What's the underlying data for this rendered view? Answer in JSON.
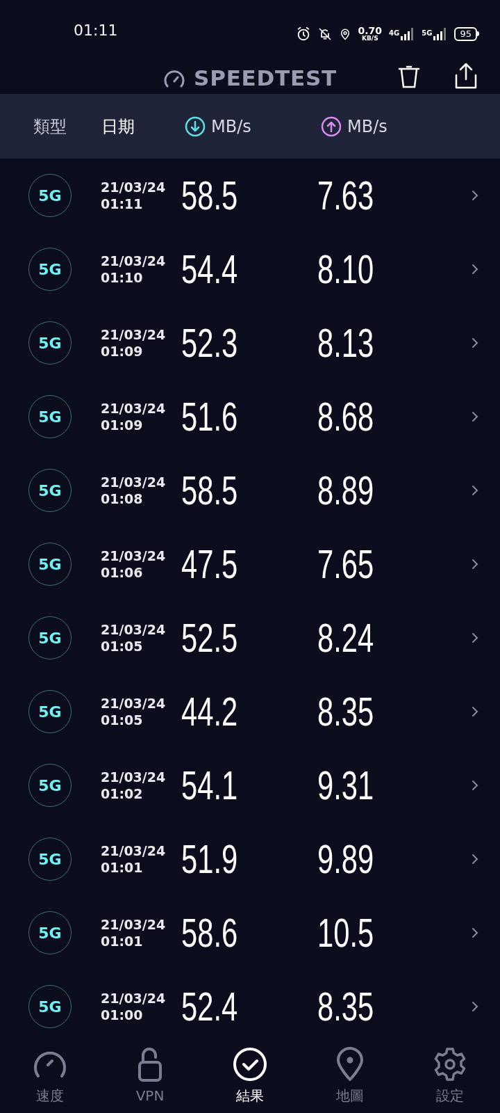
{
  "status_bar": {
    "time": "01:11",
    "net_speed": "0.70",
    "net_speed_unit": "KB/S",
    "network_1": "4G",
    "network_2": "5G",
    "battery": "95"
  },
  "header": {
    "title": "SPEEDTEST"
  },
  "columns": {
    "type": "類型",
    "date": "日期",
    "download": "MB/s",
    "upload": "MB/s"
  },
  "results": [
    {
      "type": "5G",
      "date": "21/03/24",
      "time": "01:11",
      "download": "58.5",
      "upload": "7.63"
    },
    {
      "type": "5G",
      "date": "21/03/24",
      "time": "01:10",
      "download": "54.4",
      "upload": "8.10"
    },
    {
      "type": "5G",
      "date": "21/03/24",
      "time": "01:09",
      "download": "52.3",
      "upload": "8.13"
    },
    {
      "type": "5G",
      "date": "21/03/24",
      "time": "01:09",
      "download": "51.6",
      "upload": "8.68"
    },
    {
      "type": "5G",
      "date": "21/03/24",
      "time": "01:08",
      "download": "58.5",
      "upload": "8.89"
    },
    {
      "type": "5G",
      "date": "21/03/24",
      "time": "01:06",
      "download": "47.5",
      "upload": "7.65"
    },
    {
      "type": "5G",
      "date": "21/03/24",
      "time": "01:05",
      "download": "52.5",
      "upload": "8.24"
    },
    {
      "type": "5G",
      "date": "21/03/24",
      "time": "01:05",
      "download": "44.2",
      "upload": "8.35"
    },
    {
      "type": "5G",
      "date": "21/03/24",
      "time": "01:02",
      "download": "54.1",
      "upload": "9.31"
    },
    {
      "type": "5G",
      "date": "21/03/24",
      "time": "01:01",
      "download": "51.9",
      "upload": "9.89"
    },
    {
      "type": "5G",
      "date": "21/03/24",
      "time": "01:01",
      "download": "58.6",
      "upload": "10.5"
    },
    {
      "type": "5G",
      "date": "21/03/24",
      "time": "01:00",
      "download": "52.4",
      "upload": "8.35"
    }
  ],
  "nav": [
    {
      "kind": "speed",
      "label": "速度",
      "selected": false
    },
    {
      "kind": "vpn",
      "label": "VPN",
      "selected": false
    },
    {
      "kind": "results",
      "label": "結果",
      "selected": true
    },
    {
      "kind": "map",
      "label": "地圖",
      "selected": false
    },
    {
      "kind": "settings",
      "label": "設定",
      "selected": false
    }
  ]
}
